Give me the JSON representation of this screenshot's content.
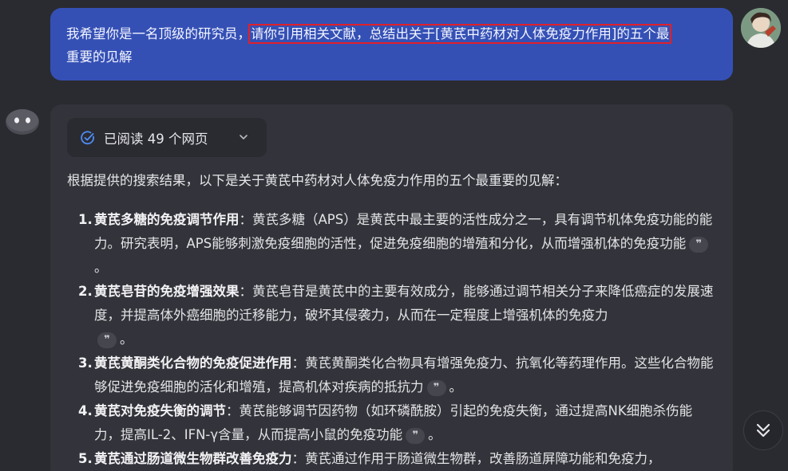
{
  "user_message": {
    "text_before": "我希望你是一名顶级的研究员，",
    "text_highlighted": "请你引用相关文献，总结出关于[黄芪中药材对人体免疫力作用]的五个最",
    "text_after": "重要的见解"
  },
  "answer": {
    "read_chip": {
      "label": "已阅读 49 个网页"
    },
    "intro": "根据提供的搜索结果，以下是关于黄芪中药材对人体免疫力作用的五个最重要的见解：",
    "cite_glyph": "❞",
    "points": [
      {
        "num": "1.",
        "head": "黄芪多糖的免疫调节作用",
        "body": "：黄芪多糖（APS）是黄芪中最主要的活性成分之一，具有调节机体免疫功能的能力。研究表明，APS能够刺激免疫细胞的活性，促进免疫细胞的增殖和分化，从而增强机体的免疫功能",
        "end": "。"
      },
      {
        "num": "2.",
        "head": "黄芪皂苷的免疫增强效果",
        "body": "：黄芪皂苷是黄芪中的主要有效成分，能够通过调节相关分子来降低癌症的发展速度，并提高体外癌细胞的迁移能力，破坏其侵袭力，从而在一定程度上增强机体的免疫力",
        "end": "。"
      },
      {
        "num": "3.",
        "head": "黄芪黄酮类化合物的免疫促进作用",
        "body": "：黄芪黄酮类化合物具有增强免疫力、抗氧化等药理作用。这些化合物能够促进免疫细胞的活化和增殖，提高机体对疾病的抵抗力",
        "end": "。"
      },
      {
        "num": "4.",
        "head": "黄芪对免疫失衡的调节",
        "body": "：黄芪能够调节因药物（如环磷酰胺）引起的免疫失衡，通过提高NK细胞杀伤能力，提高IL-2、IFN-γ含量，从而提高小鼠的免疫功能",
        "end": "。"
      },
      {
        "num": "5.",
        "head": "黄芪通过肠道微生物群改善免疫力",
        "body": "：黄芪通过作用于肠道微生物群，改善肠道屏障功能和免疫力，",
        "end": ""
      }
    ]
  },
  "colors": {
    "background": "#2a2b31",
    "user_bubble": "#3550b5",
    "answer_card": "#33343b",
    "highlight_box": "#e0202a",
    "check_accent": "#4d8cf5"
  },
  "icons": {
    "user_avatar": "user-avatar-photo",
    "bot_avatar": "bot-face-icon",
    "read_check": "check-circle-icon",
    "read_toggle": "chevron-down-icon",
    "scroll_fab": "double-chevron-down-icon"
  }
}
